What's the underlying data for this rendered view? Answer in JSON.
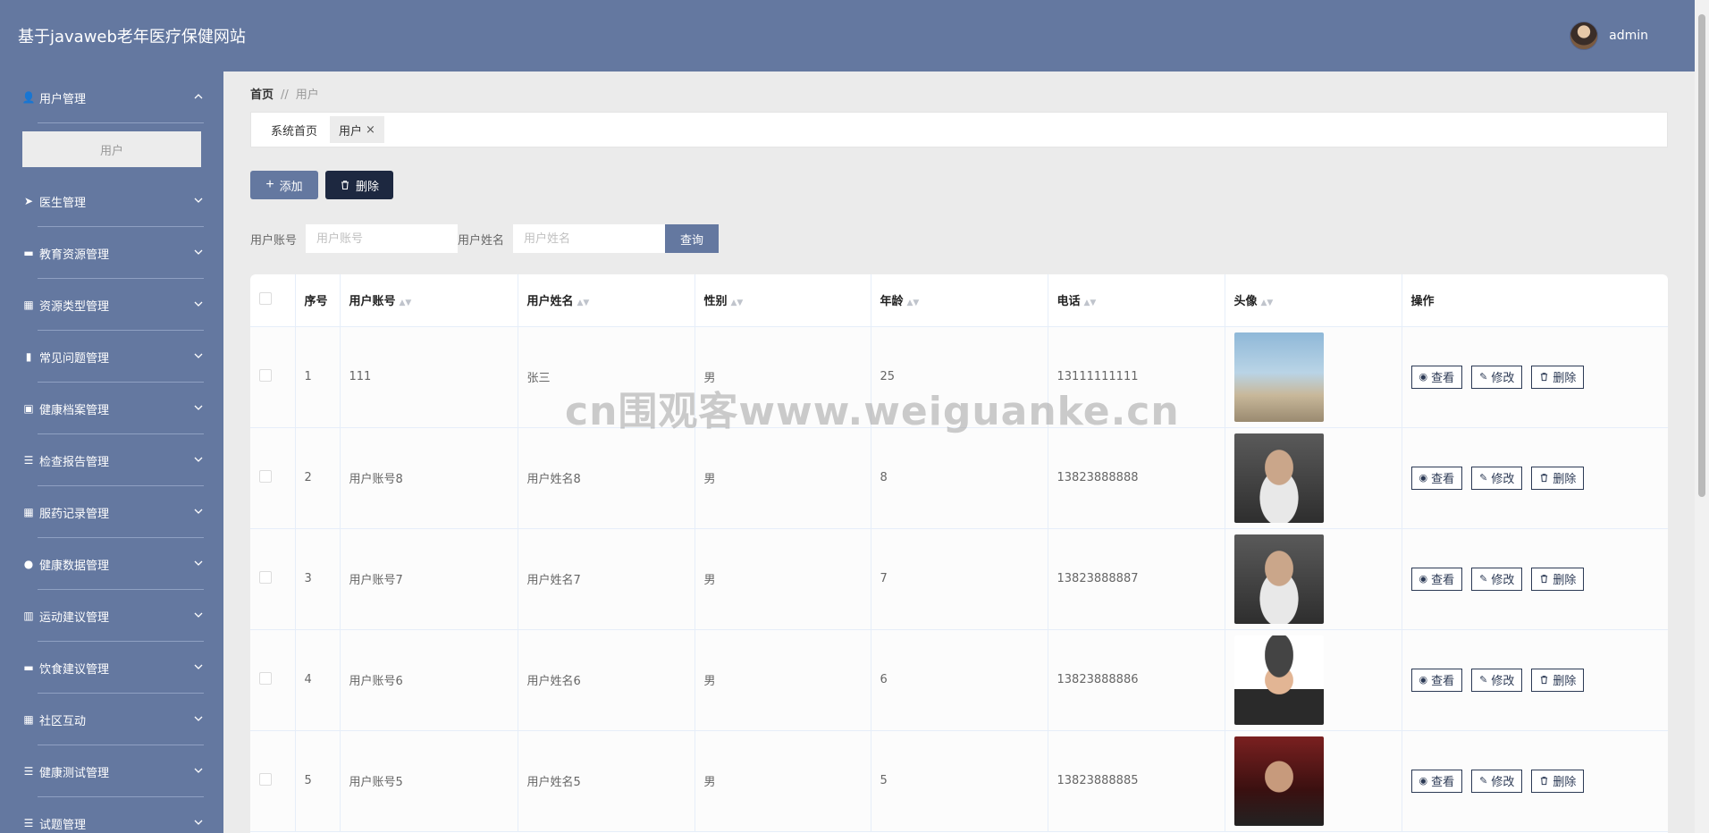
{
  "header": {
    "title": "基于javaweb老年医疗保健网站",
    "username": "admin"
  },
  "sidebar": {
    "items": [
      {
        "label": "用户管理",
        "icon": "user-icon",
        "glyph": "👤",
        "expanded": true,
        "sub": [
          "用户"
        ]
      },
      {
        "label": "医生管理",
        "icon": "paper-plane-icon",
        "glyph": "➤"
      },
      {
        "label": "教育资源管理",
        "icon": "book-icon",
        "glyph": "▬"
      },
      {
        "label": "资源类型管理",
        "icon": "grid-icon",
        "glyph": "▦"
      },
      {
        "label": "常见问题管理",
        "icon": "thumbs-up-icon",
        "glyph": "▮"
      },
      {
        "label": "健康档案管理",
        "icon": "archive-icon",
        "glyph": "▣"
      },
      {
        "label": "检查报告管理",
        "icon": "list-icon",
        "glyph": "☰"
      },
      {
        "label": "服药记录管理",
        "icon": "grid-icon",
        "glyph": "▦"
      },
      {
        "label": "健康数据管理",
        "icon": "bulb-icon",
        "glyph": "●"
      },
      {
        "label": "运动建议管理",
        "icon": "library-icon",
        "glyph": "▥"
      },
      {
        "label": "饮食建议管理",
        "icon": "ticket-icon",
        "glyph": "▬"
      },
      {
        "label": "社区互动",
        "icon": "grid-icon",
        "glyph": "▦"
      },
      {
        "label": "健康测试管理",
        "icon": "menu-icon",
        "glyph": "☰"
      },
      {
        "label": "试题管理",
        "icon": "menu-icon",
        "glyph": "☰"
      }
    ]
  },
  "breadcrumb": {
    "home": "首页",
    "sep": "//",
    "current": "用户"
  },
  "tabs": [
    {
      "label": "系统首页"
    },
    {
      "label": "用户",
      "close": "×"
    }
  ],
  "toolbar": {
    "add_label": "添加",
    "delete_label": "删除"
  },
  "search": {
    "account_label": "用户账号",
    "account_placeholder": "用户账号",
    "name_label": "用户姓名",
    "name_placeholder": "用户姓名",
    "query_label": "查询"
  },
  "table": {
    "columns": [
      "序号",
      "用户账号",
      "用户姓名",
      "性别",
      "年龄",
      "电话",
      "头像",
      "操作"
    ],
    "op_labels": {
      "view": "查看",
      "edit": "修改",
      "delete": "删除"
    },
    "rows": [
      {
        "index": "1",
        "account": "111",
        "name": "张三",
        "gender": "男",
        "age": "25",
        "phone": "13111111111"
      },
      {
        "index": "2",
        "account": "用户账号8",
        "name": "用户姓名8",
        "gender": "男",
        "age": "8",
        "phone": "13823888888"
      },
      {
        "index": "3",
        "account": "用户账号7",
        "name": "用户姓名7",
        "gender": "男",
        "age": "7",
        "phone": "13823888887"
      },
      {
        "index": "4",
        "account": "用户账号6",
        "name": "用户姓名6",
        "gender": "男",
        "age": "6",
        "phone": "13823888886"
      },
      {
        "index": "5",
        "account": "用户账号5",
        "name": "用户姓名5",
        "gender": "男",
        "age": "5",
        "phone": "13823888885"
      }
    ]
  },
  "watermark": "cn围观客www.weiguanke.cn",
  "colors": {
    "primary": "#6478a0",
    "dark": "#1d2840",
    "background": "#ebebeb"
  }
}
